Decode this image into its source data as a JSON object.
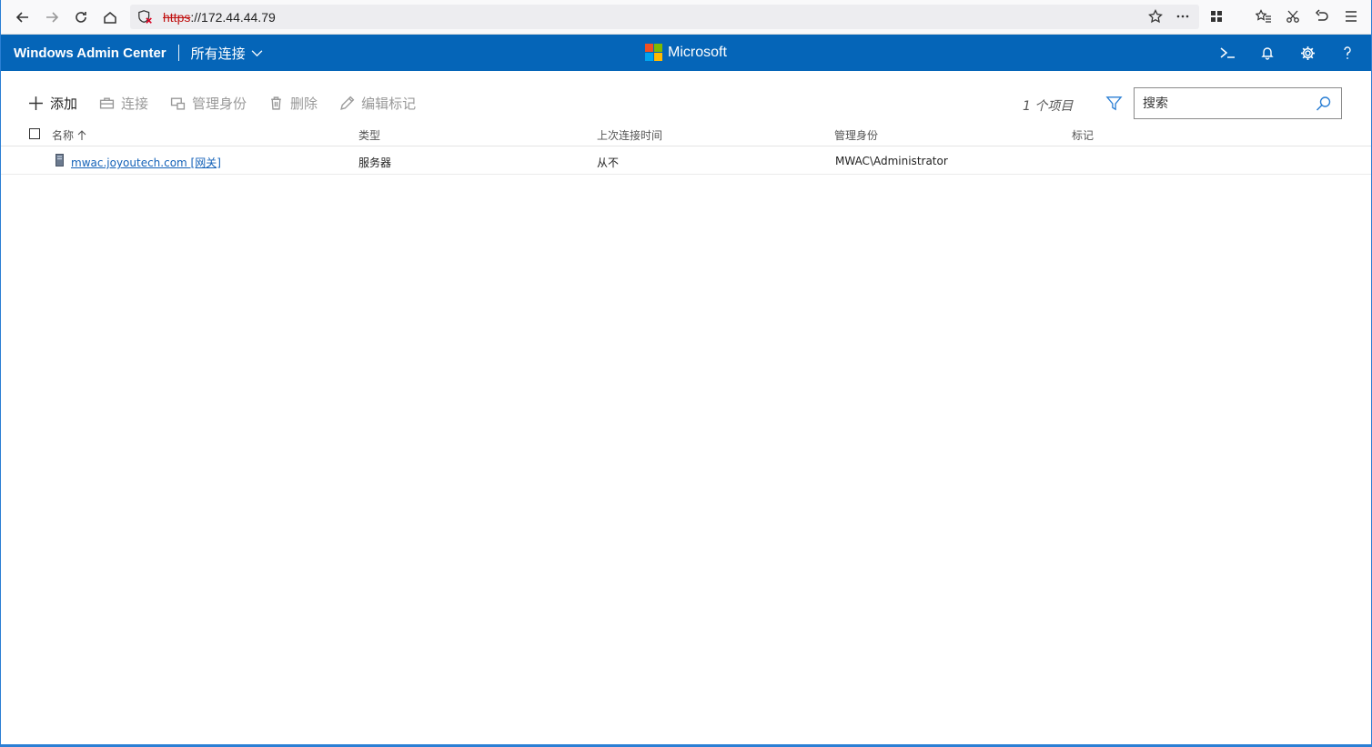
{
  "browser": {
    "url_scheme": "https",
    "url_rest": "://172.44.44.79"
  },
  "header": {
    "app_title": "Windows Admin Center",
    "connections_label": "所有连接",
    "brand": "Microsoft",
    "brand_colors": [
      "#f25022",
      "#7fba00",
      "#00a4ef",
      "#ffb900"
    ]
  },
  "toolbar": {
    "add": "添加",
    "connect": "连接",
    "manage_as": "管理身份",
    "delete": "删除",
    "edit_tags": "编辑标记"
  },
  "list": {
    "item_count": "1 个项目",
    "search_placeholder": "搜索"
  },
  "table": {
    "columns": {
      "name": "名称",
      "type": "类型",
      "last_connected": "上次连接时间",
      "managed_as": "管理身份",
      "tags": "标记"
    },
    "rows": [
      {
        "name": "mwac.joyoutech.com [网关]",
        "type": "服务器",
        "last_connected": "从不",
        "managed_as": "MWAC\\Administrator",
        "tags": ""
      }
    ]
  }
}
